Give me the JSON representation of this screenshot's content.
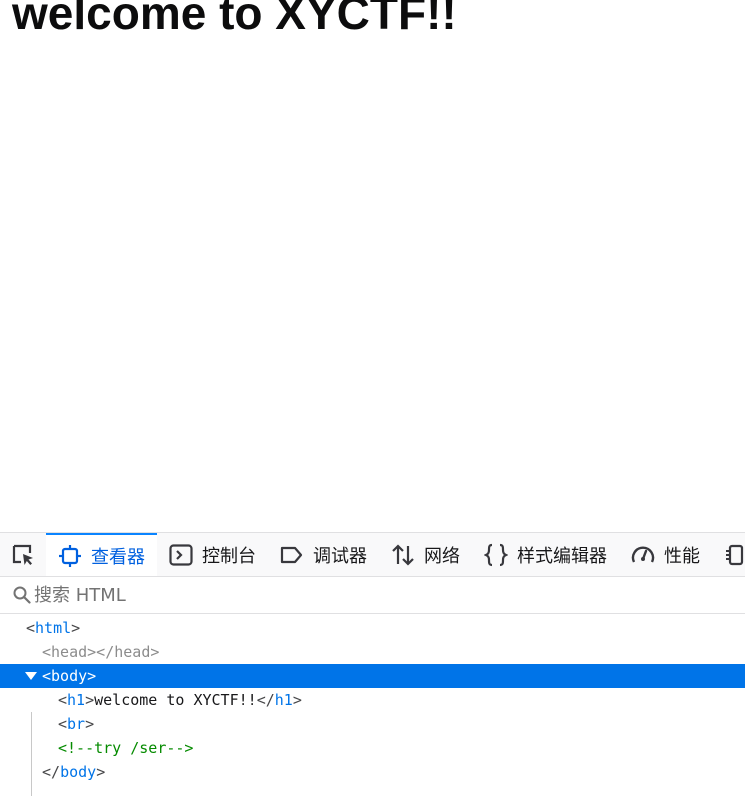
{
  "page": {
    "heading": "welcome to XYCTF!!"
  },
  "devtools": {
    "tabs": [
      {
        "label": "查看器",
        "icon": "inspector-icon",
        "selected": true
      },
      {
        "label": "控制台",
        "icon": "console-icon",
        "selected": false
      },
      {
        "label": "调试器",
        "icon": "debugger-icon",
        "selected": false
      },
      {
        "label": "网络",
        "icon": "network-icon",
        "selected": false
      },
      {
        "label": "样式编辑器",
        "icon": "style-editor-icon",
        "selected": false
      },
      {
        "label": "性能",
        "icon": "performance-icon",
        "selected": false
      }
    ],
    "search": {
      "placeholder": "搜索 HTML"
    },
    "tree": {
      "html_open": "html",
      "head": "head",
      "body_open": "body",
      "h1_tag": "h1",
      "h1_text": "welcome to XYCTF!!",
      "br_tag": "br",
      "comment": "<!--try /ser-->",
      "body_close": "body"
    },
    "colors": {
      "selection": "#0074e8",
      "tag": "#0074e8",
      "comment": "#058b00",
      "selected_tab": "#0060df"
    }
  }
}
